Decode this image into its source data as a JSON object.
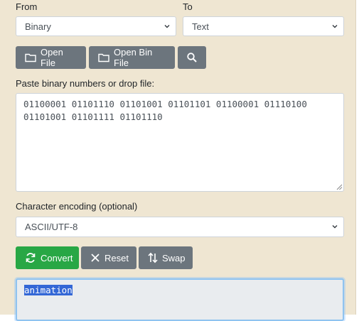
{
  "from": {
    "label": "From",
    "selected": "Binary"
  },
  "to": {
    "label": "To",
    "selected": "Text"
  },
  "toolbar": {
    "open_file": "Open File",
    "open_bin_file": "Open Bin File"
  },
  "input": {
    "label": "Paste binary numbers or drop file:",
    "value": "01100001 01101110 01101001 01101101 01100001 01110100\n01101001 01101111 01101110"
  },
  "encoding": {
    "label": "Character encoding (optional)",
    "selected": "ASCII/UTF-8"
  },
  "actions": {
    "convert": "Convert",
    "reset": "Reset",
    "swap": "Swap"
  },
  "output": {
    "value": "animation"
  },
  "colors": {
    "panel": "#efe6d2",
    "gray_button": "#6c757d",
    "green_button": "#28a745",
    "selection": "#3367d6"
  },
  "icons": [
    "chevron-down-icon",
    "folder-icon",
    "search-icon",
    "refresh-icon",
    "close-icon",
    "swap-icon",
    "resize-handle-icon"
  ]
}
